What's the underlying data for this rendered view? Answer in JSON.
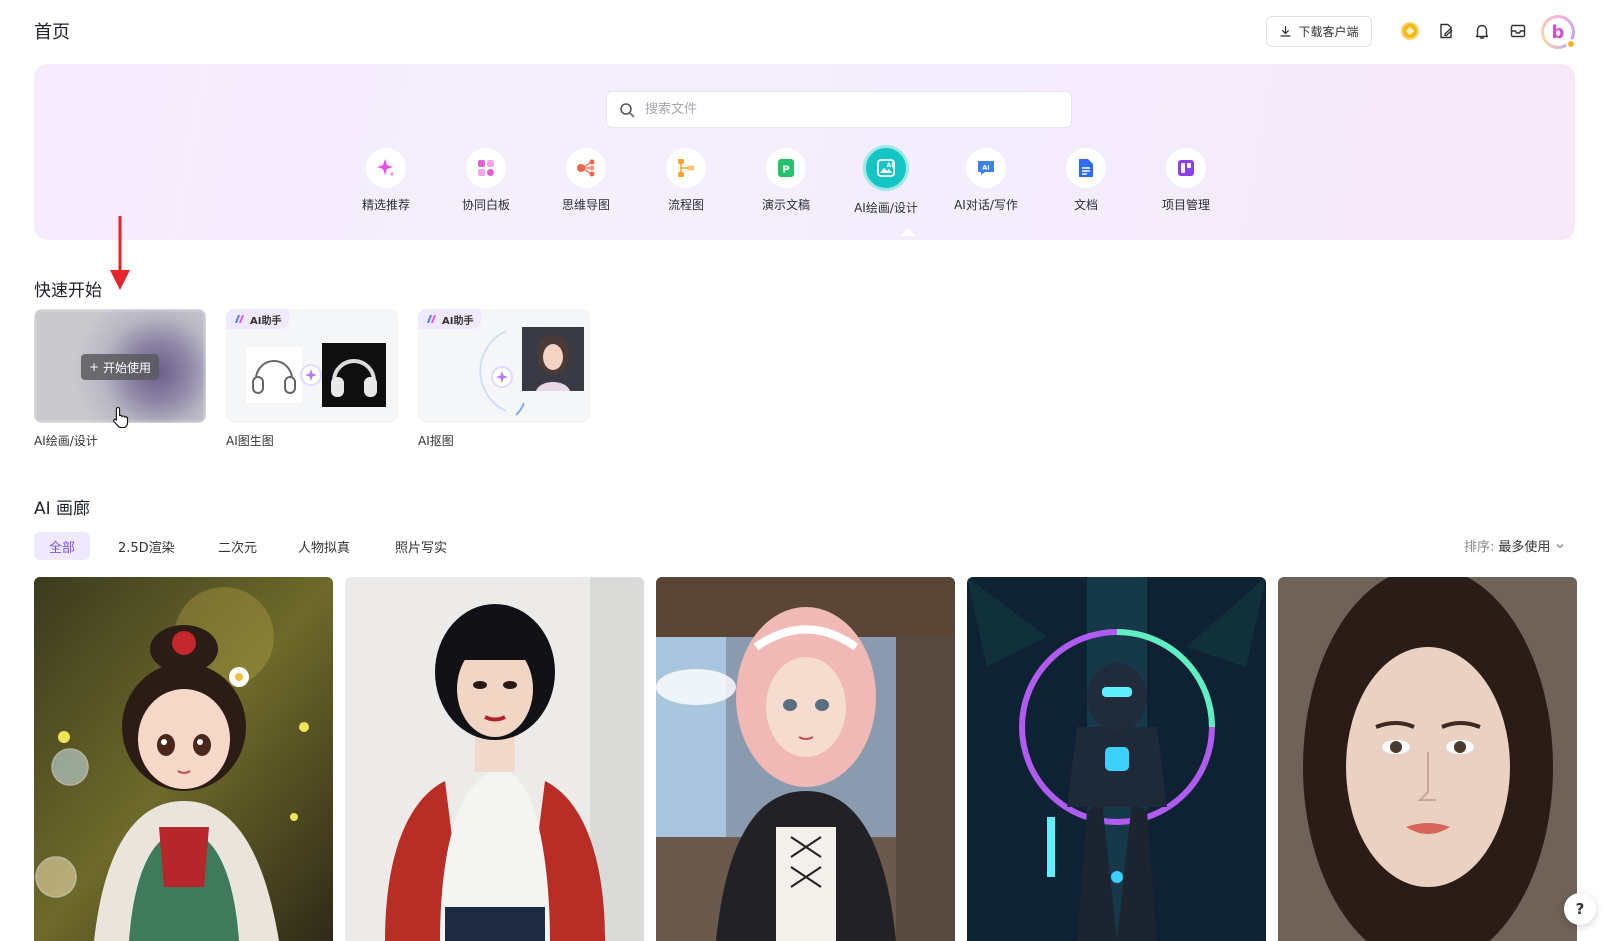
{
  "header": {
    "title": "首页",
    "download_label": "下载客户端"
  },
  "search": {
    "placeholder": "搜索文件"
  },
  "categories": [
    {
      "label": "精选推荐",
      "icon": "sparkle-icon",
      "color": "#e352e0"
    },
    {
      "label": "协同白板",
      "icon": "whiteboard-icon",
      "color": "#e05fd5"
    },
    {
      "label": "思维导图",
      "icon": "mindmap-icon",
      "color": "#f2644c"
    },
    {
      "label": "流程图",
      "icon": "flowchart-icon",
      "color": "#f8a42b"
    },
    {
      "label": "演示文稿",
      "icon": "presentation-icon",
      "color": "#24c26a"
    },
    {
      "label": "AI绘画/设计",
      "icon": "ai-paint-icon",
      "color": "#14c5c5"
    },
    {
      "label": "AI对话/写作",
      "icon": "ai-chat-icon",
      "color": "#3b82f6"
    },
    {
      "label": "文档",
      "icon": "document-icon",
      "color": "#2f6bff"
    },
    {
      "label": "项目管理",
      "icon": "project-icon",
      "color": "#8b3fe6"
    }
  ],
  "quick_start": {
    "title": "快速开始",
    "start_label": "开始使用",
    "badge_label": "AI助手",
    "cards": [
      {
        "label": "AI绘画/设计"
      },
      {
        "label": "AI图生图"
      },
      {
        "label": "AI抠图"
      }
    ]
  },
  "gallery": {
    "title": "AI 画廊",
    "tabs": [
      "全部",
      "2.5D渲染",
      "二次元",
      "人物拟真",
      "照片写实"
    ],
    "active_tab": "全部",
    "sort_prefix": "排序:",
    "sort_value": "最多使用"
  },
  "help_label": "?",
  "colors": {
    "accent": "#7b53e6",
    "active_category": "#14c5c5",
    "arrow": "#e5242b"
  }
}
